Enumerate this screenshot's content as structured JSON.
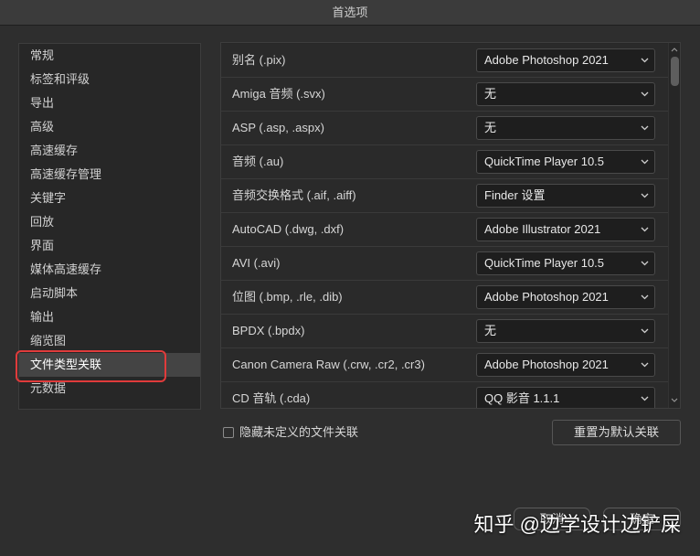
{
  "window": {
    "title": "首选项"
  },
  "sidebar": {
    "items": [
      {
        "label": "常规"
      },
      {
        "label": "标签和评级"
      },
      {
        "label": "导出"
      },
      {
        "label": "高级"
      },
      {
        "label": "高速缓存"
      },
      {
        "label": "高速缓存管理"
      },
      {
        "label": "关键字"
      },
      {
        "label": "回放"
      },
      {
        "label": "界面"
      },
      {
        "label": "媒体高速缓存"
      },
      {
        "label": "启动脚本"
      },
      {
        "label": "输出"
      },
      {
        "label": "缩览图"
      },
      {
        "label": "文件类型关联",
        "selected": true
      },
      {
        "label": "元数据"
      }
    ]
  },
  "associations": {
    "rows": [
      {
        "file_type": "别名 (.pix)",
        "app": "Adobe Photoshop 2021"
      },
      {
        "file_type": "Amiga 音频 (.svx)",
        "app": "无"
      },
      {
        "file_type": "ASP (.asp, .aspx)",
        "app": "无"
      },
      {
        "file_type": "音频 (.au)",
        "app": "QuickTime Player 10.5"
      },
      {
        "file_type": "音频交换格式 (.aif, .aiff)",
        "app": "Finder 设置"
      },
      {
        "file_type": "AutoCAD (.dwg, .dxf)",
        "app": "Adobe Illustrator 2021"
      },
      {
        "file_type": "AVI (.avi)",
        "app": "QuickTime Player 10.5"
      },
      {
        "file_type": "位图 (.bmp, .rle, .dib)",
        "app": "Adobe Photoshop 2021"
      },
      {
        "file_type": "BPDX (.bpdx)",
        "app": "无"
      },
      {
        "file_type": "Canon Camera Raw (.crw, .cr2, .cr3)",
        "app": "Adobe Photoshop 2021"
      },
      {
        "file_type": "CD 音轨 (.cda)",
        "app": "QQ 影音 1.1.1"
      }
    ]
  },
  "hide_undefined": {
    "label": "隐藏未定义的文件关联",
    "checked": false
  },
  "reset_button": {
    "label": "重置为默认关联"
  },
  "footer": {
    "cancel_label": "取消",
    "ok_label": "确定"
  },
  "watermark": {
    "text": "知乎 @边学设计边铲屎"
  },
  "icons": {
    "select_chevron": "chevron-down-icon",
    "scroll_up": "chevron-up-icon",
    "scroll_down": "chevron-down-icon"
  },
  "colors": {
    "background": "#2e2e2e",
    "selected_item": "#444444",
    "annotation": "#e03b3b",
    "text": "#d4d4d4"
  }
}
